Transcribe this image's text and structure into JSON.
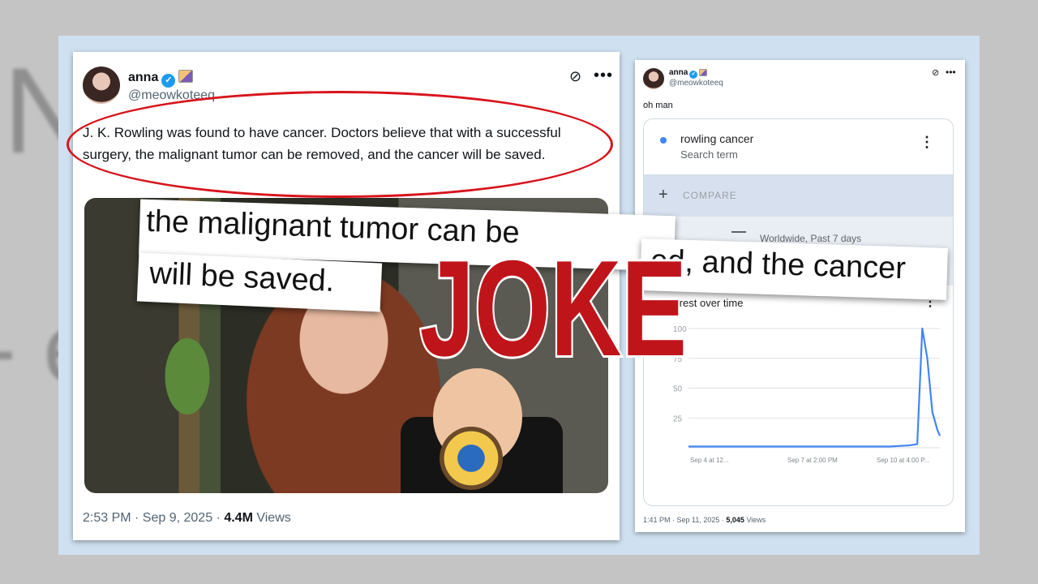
{
  "left_tweet": {
    "name": "anna",
    "handle": "@meowkoteeq",
    "text": "J. K. Rowling was found to have cancer. Doctors believe that with a successful surgery, the malignant tumor can be removed, and the cancer will be saved.",
    "time": "2:53 PM · Sep 9, 2025 · ",
    "views_count": "4.4M",
    "views_label": " Views",
    "more_icon": "•••"
  },
  "right_tweet": {
    "name": "anna",
    "handle": "@meowkoteeq",
    "text": "oh man",
    "time": "1:41 PM · Sep 11, 2025 · ",
    "views_count": "5,045",
    "views_label": " Views",
    "more_icon": "•••",
    "trends": {
      "term": "rowling cancer",
      "term_sub": "Search term",
      "compare": "COMPARE",
      "filter": "Worldwide, Past 7 days",
      "chart_title": "Interest over time"
    }
  },
  "chart_data": {
    "type": "line",
    "title": "Interest over time",
    "xlabel": "",
    "ylabel": "",
    "ylim": [
      0,
      100
    ],
    "yticks": [
      25,
      50,
      75,
      100
    ],
    "x_tick_labels": [
      "Sep 4 at 12...",
      "Sep 7 at 2:00 PM",
      "Sep 10 at 4:00 P..."
    ],
    "series": [
      {
        "color": "#4285f4",
        "x": [
          0,
          10,
          20,
          30,
          40,
          50,
          60,
          70,
          80,
          88,
          91,
          93,
          95,
          97,
          99,
          100
        ],
        "y": [
          1,
          1,
          1,
          1,
          1,
          1,
          1,
          1,
          1,
          2,
          3,
          100,
          75,
          30,
          15,
          10
        ]
      }
    ]
  },
  "overlay": {
    "clip_a": "the malignant tumor can be",
    "clip_b": "will be saved.",
    "clip_c": "ed, and the cancer",
    "stamp": "JOKE"
  },
  "colors": {
    "oval": "#d8141c",
    "stamp": "#c0141b",
    "verified": "#1d9bf0",
    "trend_line": "#4285f4"
  }
}
